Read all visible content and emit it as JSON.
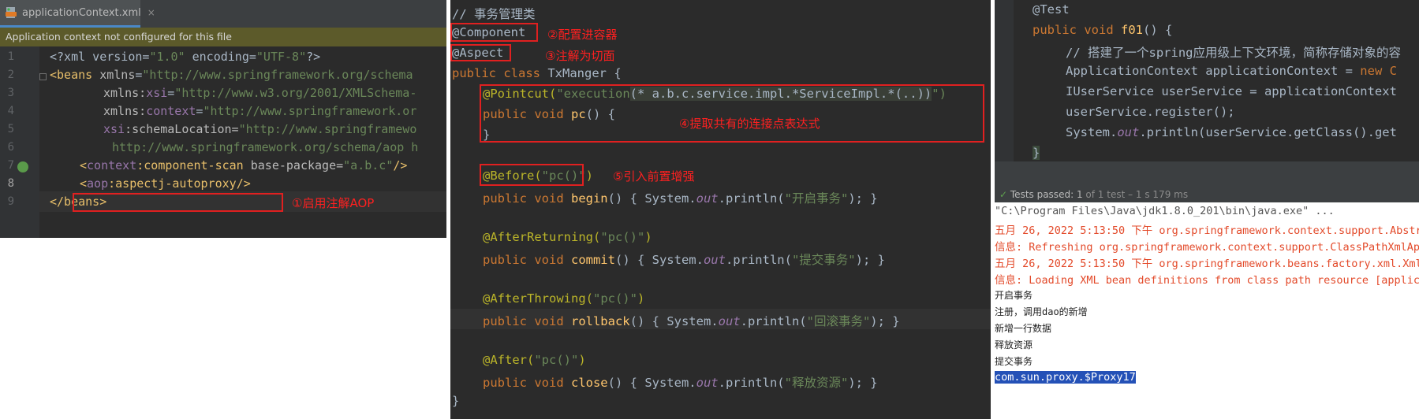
{
  "panel1": {
    "tab": {
      "filename": "applicationContext.xml",
      "close_glyph": "×",
      "icon": "xml-file-icon"
    },
    "notice": "Application context not configured for this file",
    "line_numbers": [
      "1",
      "2",
      "3",
      "4",
      "5",
      "6",
      "7",
      "8",
      "9"
    ],
    "lines": {
      "l1_a": "<?xml version=",
      "l1_b": "\"1.0\"",
      "l1_c": " encoding=",
      "l1_d": "\"UTF-8\"",
      "l1_e": "?>",
      "l2_a": "<beans",
      "l2_b": " xmlns",
      "l2_c": "=",
      "l2_d": "\"http://www.springframework.org/schema",
      "l3_a": "xmlns:",
      "l3_b": "xsi",
      "l3_c": "=",
      "l3_d": "\"http://www.w3.org/2001/XMLSchema-",
      "l4_a": "xmlns:",
      "l4_b": "context",
      "l4_c": "=",
      "l4_d": "\"http://www.springframework.or",
      "l5_a": "xsi",
      "l5_b": ":schemaLocation=",
      "l5_c": "\"http://www.springframewo",
      "l6": "http://www.springframework.org/schema/aop h",
      "l7_a": "<",
      "l7_b": "context",
      "l7_c": ":component-scan",
      "l7_d": " base-package=",
      "l7_e": "\"a.b.c\"",
      "l7_f": "/>",
      "l8_a": "<",
      "l8_b": "aop",
      "l8_c": ":aspectj-autoproxy",
      "l8_d": "/>",
      "l9": "</beans>"
    },
    "annotation": "①启用注解AOP"
  },
  "panel2": {
    "lines": {
      "comment": "// 事务管理类",
      "component": "@Component",
      "aspect": "@Aspect",
      "class_kw": "public class ",
      "class_name": "TxManger {",
      "pointcut_a": "@Pointcut(",
      "pointcut_b": "\"execution",
      "pointcut_c": "(* a.b.c.service.impl.*ServiceImpl.*(..))",
      "pointcut_d": "\")",
      "pc_kw": "public void ",
      "pc_name": "pc",
      "pc_rest": "() {",
      "close_brace": "}",
      "before_a": "@Before(",
      "before_b": "\"pc()\"",
      "before_c": ")",
      "begin_kw": "public void ",
      "begin_name": "begin",
      "begin_rest": "() { System.",
      "begin_out": "out",
      "begin_print": ".println(",
      "begin_str": "\"开启事务\"",
      "begin_end": "); }",
      "ar_a": "@AfterReturning(",
      "ar_b": "\"pc()\"",
      "ar_c": ")",
      "commit_kw": "public void ",
      "commit_name": "commit",
      "commit_rest": "() { System.",
      "commit_out": "out",
      "commit_print": ".println(",
      "commit_str": "\"提交事务\"",
      "commit_end": "); }",
      "at_a": "@AfterThrowing(",
      "at_b": "\"pc()\"",
      "at_c": ")",
      "rb_kw": "public void ",
      "rb_name": "rollback",
      "rb_rest": "() { System.",
      "rb_out": "out",
      "rb_print": ".println(",
      "rb_str": "\"回滚事务\"",
      "rb_end": "); }",
      "after_a": "@After(",
      "after_b": "\"pc()\"",
      "after_c": ")",
      "close_kw": "public void ",
      "close_name": "close",
      "close_rest": "() { System.",
      "close_out": "out",
      "close_print": ".println(",
      "close_str": "\"释放资源\"",
      "close_end": "); }",
      "final_brace": "}"
    },
    "annotations": {
      "a1": "②配置进容器",
      "a2": "③注解为切面",
      "a3": "④提取共有的连接点表达式",
      "a4": "⑤引入前置增强"
    }
  },
  "panel3": {
    "code": {
      "test": "@Test",
      "sig_kw": "public void ",
      "sig_name": "f01",
      "sig_rest": "() {",
      "comment": "// 搭建了一个spring应用级上下文环境，简称存储对象的容",
      "ac_a": "ApplicationContext applicationContext = ",
      "ac_b": "new C",
      "us": "IUserService userService = applicationContext",
      "reg": "userService.register();",
      "sys_a": "System.",
      "sys_out": "out",
      "sys_b": ".println(userService.getClass().get",
      "brace": "}"
    },
    "status": {
      "label": "Tests passed:",
      "count": "1",
      "rest": "of 1 test – 1 s 179 ms"
    },
    "console": [
      "\"C:\\Program Files\\Java\\jdk1.8.0_201\\bin\\java.exe\" ...",
      "五月 26, 2022 5:13:50 下午 org.springframework.context.support.Abstra",
      "信息: Refreshing org.springframework.context.support.ClassPathXmlApp",
      "五月 26, 2022 5:13:50 下午 org.springframework.beans.factory.xml.XmlB",
      "信息: Loading XML bean definitions from class path resource [applica",
      "开启事务",
      "注册，调用dao的新增",
      "新增一行数据",
      "释放资源",
      "提交事务",
      "com.sun.proxy.$Proxy17"
    ]
  },
  "colors": {
    "editor_bg": "#2b2b2b",
    "keyword": "#cc7832",
    "string": "#6a8759",
    "annotation": "#bbb529",
    "method": "#ffc66d",
    "red_note": "#ff2020"
  }
}
